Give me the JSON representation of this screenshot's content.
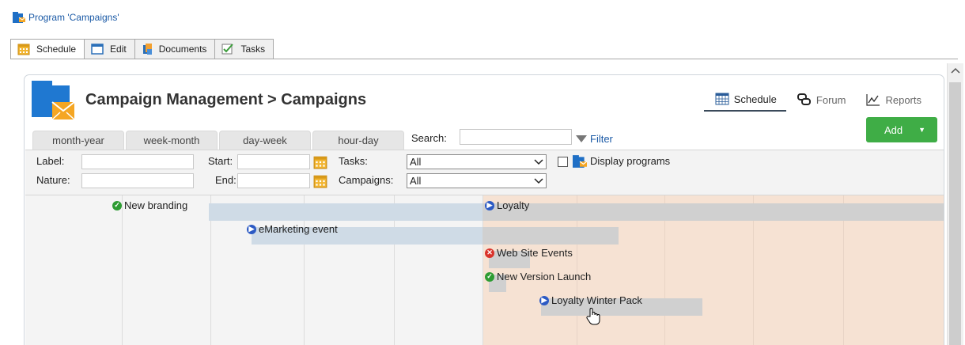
{
  "window": {
    "title": "Program 'Campaigns'"
  },
  "main_tabs": [
    {
      "label": "Schedule",
      "icon": "calendar-icon",
      "active": true
    },
    {
      "label": "Edit",
      "icon": "edit-icon",
      "active": false
    },
    {
      "label": "Documents",
      "icon": "documents-icon",
      "active": false
    },
    {
      "label": "Tasks",
      "icon": "tasks-icon",
      "active": false
    }
  ],
  "header": {
    "title": "Campaign Management > Campaigns",
    "links": [
      {
        "label": "Schedule",
        "icon": "calendar-icon",
        "active": true
      },
      {
        "label": "Forum",
        "icon": "forum-icon",
        "active": false
      },
      {
        "label": "Reports",
        "icon": "chart-icon",
        "active": false
      }
    ],
    "add_label": "Add"
  },
  "view_tabs": [
    "month-year",
    "week-month",
    "day-week",
    "hour-day"
  ],
  "search": {
    "label": "Search:",
    "value": "",
    "filter_label": "Filter"
  },
  "filters": {
    "label_lbl": "Label:",
    "nature_lbl": "Nature:",
    "start_lbl": "Start:",
    "end_lbl": "End:",
    "tasks_lbl": "Tasks:",
    "tasks_value": "All",
    "campaigns_lbl": "Campaigns:",
    "campaigns_value": "All",
    "display_programs": "Display programs"
  },
  "gantt": {
    "items": [
      {
        "label": "New branding",
        "status": "completed"
      },
      {
        "label": "Loyalty",
        "status": "in-progress"
      },
      {
        "label": "eMarketing event",
        "status": "in-progress"
      },
      {
        "label": "Web Site Events",
        "status": "cancelled"
      },
      {
        "label": "New Version Launch",
        "status": "completed"
      },
      {
        "label": "Loyalty Winter Pack",
        "status": "in-progress"
      }
    ]
  },
  "colors": {
    "accent": "#1b5aa6",
    "add_button": "#3fad46",
    "future_zone": "#f6e2d3",
    "bar_past": "#cfdbe6",
    "bar_future": "#d0d0d0"
  }
}
